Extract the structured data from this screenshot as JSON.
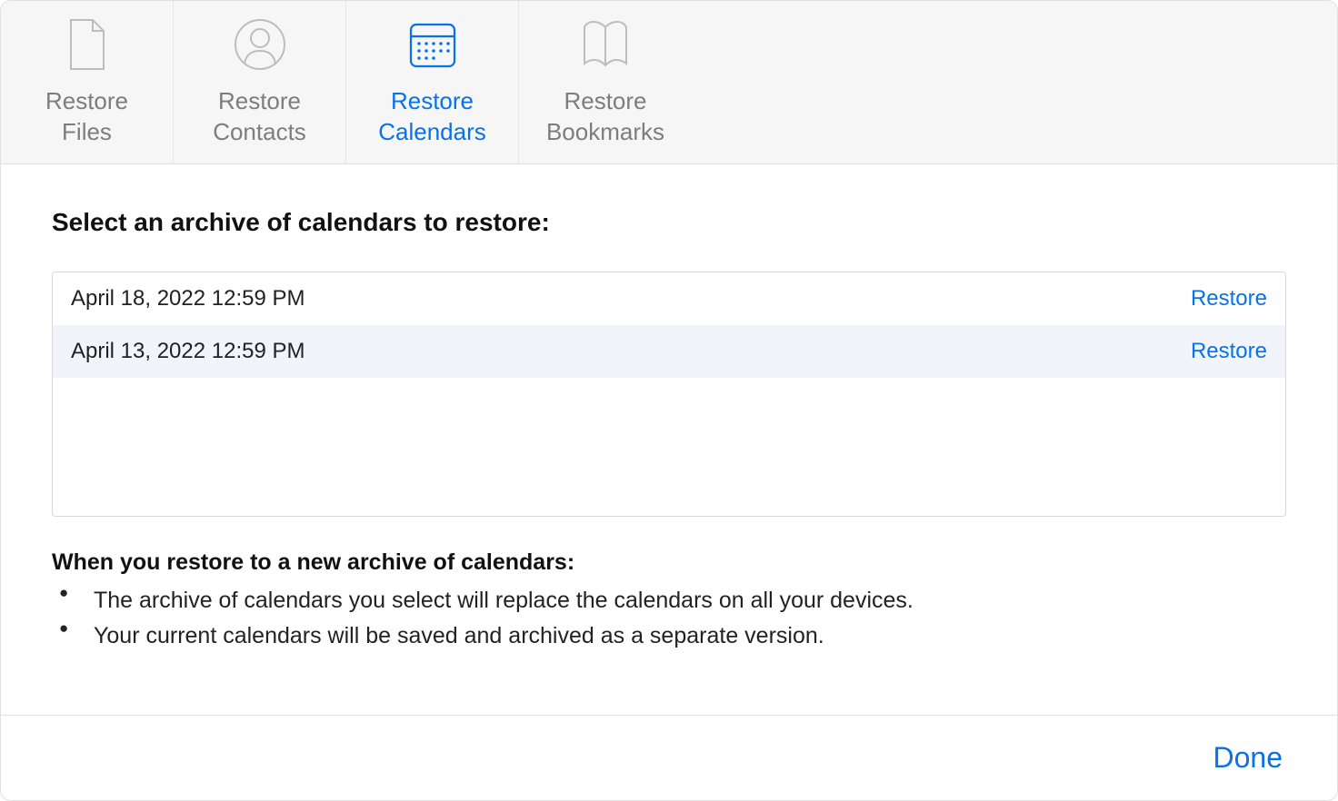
{
  "tabs": {
    "files": "Restore\nFiles",
    "contacts": "Restore\nContacts",
    "calendars": "Restore\nCalendars",
    "bookmarks": "Restore\nBookmarks"
  },
  "heading": "Select an archive of calendars to restore:",
  "archives": [
    {
      "date": "April 18, 2022 12:59 PM",
      "action": "Restore"
    },
    {
      "date": "April 13, 2022 12:59 PM",
      "action": "Restore"
    }
  ],
  "note_heading": "When you restore to a new archive of calendars:",
  "bullets": [
    "The archive of calendars you select will replace the calendars on all your devices.",
    "Your current calendars will be saved and archived as a separate version."
  ],
  "done_label": "Done"
}
